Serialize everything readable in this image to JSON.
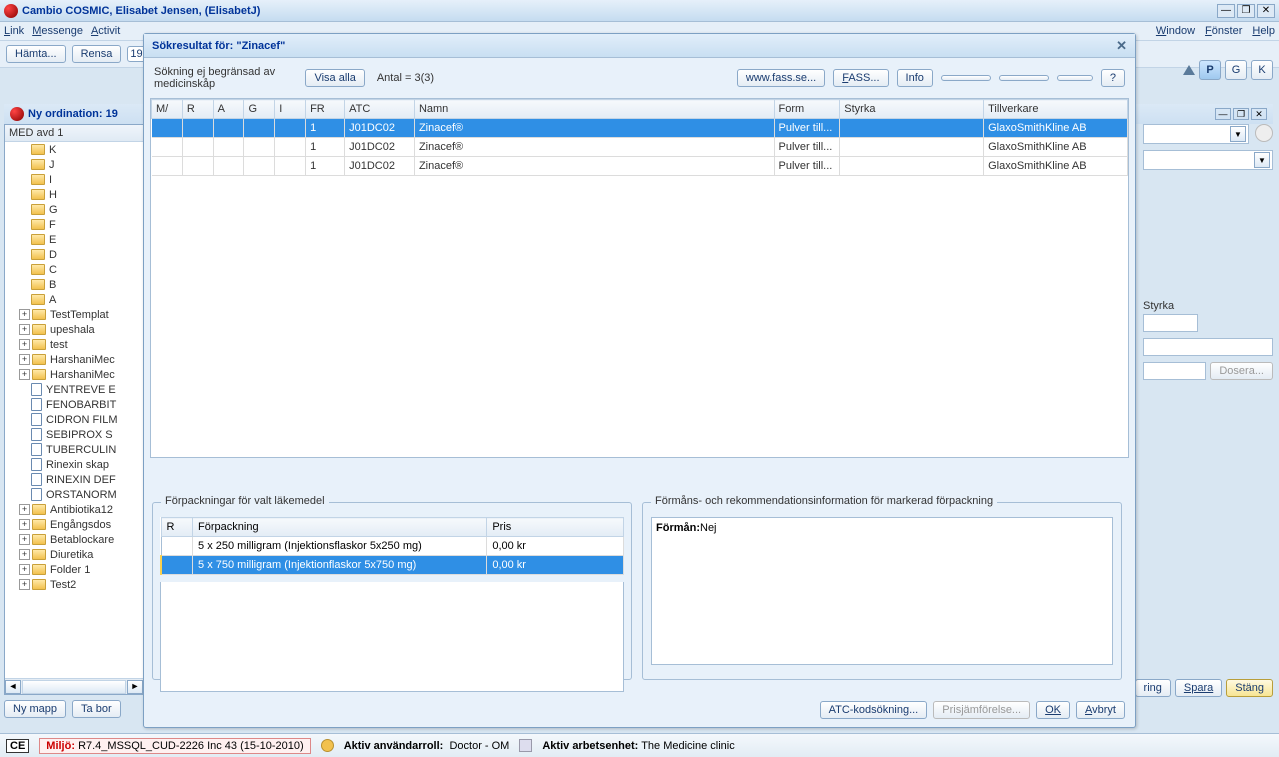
{
  "title": "Cambio COSMIC, Elisabet Jensen, (ElisabetJ)",
  "menu": {
    "link": "Link",
    "mess": "Messenge",
    "act": "Activit",
    "window": "Window",
    "fonster": "Fönster",
    "help": "Help"
  },
  "toolbar": {
    "hamta": "Hämta...",
    "rensa": "Rensa",
    "field": "19"
  },
  "rtbtns": {
    "p": "P",
    "g": "G",
    "k": "K"
  },
  "sub": {
    "title": "Ny ordination:  19"
  },
  "left": {
    "header": "MED avd 1",
    "letters": [
      "K",
      "J",
      "I",
      "H",
      "G",
      "F",
      "E",
      "D",
      "C",
      "B",
      "A"
    ],
    "folders": [
      "TestTemplat",
      "upeshala",
      "test",
      "HarshaniMec",
      "HarshaniMec"
    ],
    "docs": [
      "YENTREVE E",
      "FENOBARBIT",
      "CIDRON FILM",
      "SEBIPROX S",
      "TUBERCULIN",
      "Rinexin skap",
      "RINEXIN DEF",
      "ORSTANORM"
    ],
    "folders2": [
      "Antibiotika12",
      "Engångsdos",
      "Betablockare",
      "Diuretika",
      "Folder 1",
      "Test2"
    ]
  },
  "leftbtm": {
    "ny": "Ny mapp",
    "ta": "Ta bor"
  },
  "dlg": {
    "title": "Sökresultat för: \"Zinacef\"",
    "info": "Sökning ej begränsad av medicinskåp",
    "visa": "Visa alla",
    "antal": "Antal = 3(3)",
    "fassse": "www.fass.se...",
    "fass": "FASS...",
    "infoBtn": "Info",
    "q": "?",
    "cols": [
      "M/",
      "R",
      "A",
      "G",
      "I",
      "FR",
      "ATC",
      "Namn",
      "Form",
      "Styrka",
      "Tillverkare"
    ],
    "rows": [
      {
        "fr": "1",
        "atc": "J01DC02",
        "namn": "Zinacef®",
        "form": "Pulver till...",
        "styrka": "",
        "tillv": "GlaxoSmithKline AB",
        "sel": true
      },
      {
        "fr": "1",
        "atc": "J01DC02",
        "namn": "Zinacef®",
        "form": "Pulver till...",
        "styrka": "",
        "tillv": "GlaxoSmithKline AB"
      },
      {
        "fr": "1",
        "atc": "J01DC02",
        "namn": "Zinacef®",
        "form": "Pulver till...",
        "styrka": "",
        "tillv": "GlaxoSmithKline AB"
      }
    ],
    "g1": {
      "legend": "Förpackningar för valt läkemedel",
      "cols": [
        "R",
        "Förpackning",
        "Pris"
      ],
      "rows": [
        {
          "r": "",
          "f": "5 x 250 milligram (Injektionsflaskor 5x250 mg)",
          "p": "0,00 kr"
        },
        {
          "r": "",
          "f": "5 x 750 milligram (Injektionflaskor 5x750 mg)",
          "p": "0,00 kr",
          "sel": true
        }
      ]
    },
    "g2": {
      "legend": "Förmåns- och rekommendationsinformation för markerad förpackning",
      "lbl": "Förmån:",
      "val": "Nej"
    },
    "btm": {
      "atc": "ATC-kodsökning...",
      "pris": "Prisjämförelse...",
      "ok": "OK",
      "av": "Avbryt"
    }
  },
  "rt": {
    "styrka": "Styrka",
    "dosera": "Dosera...",
    "ring": "ring",
    "spara": "Spara",
    "stang": "Stäng"
  },
  "status": {
    "ce": "CE",
    "miljo_lbl": "Miljö:",
    "miljo": "R7.4_MSSQL_CUD-2226  Inc 43 (15-10-2010)",
    "roll_lbl": "Aktiv användarroll:",
    "roll": "Doctor - OM",
    "enh_lbl": "Aktiv arbetsenhet:",
    "enh": "The Medicine clinic"
  }
}
